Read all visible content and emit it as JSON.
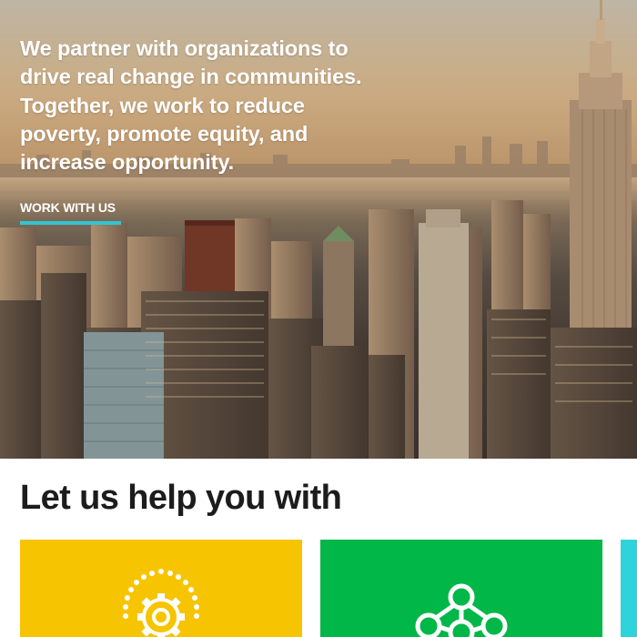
{
  "hero": {
    "text": "We partner with organizations to drive real change in communities. Together, we work to reduce poverty, promote equity, and increase opportunity.",
    "cta_label": "WORK WITH US",
    "accent_color": "#33c5d1"
  },
  "help_section": {
    "title": "Let us help you with",
    "cards": [
      {
        "color": "#f6c400",
        "icon": "gear-icon"
      },
      {
        "color": "#00b747",
        "icon": "network-icon"
      },
      {
        "color": "#2fd3dc",
        "icon": ""
      }
    ]
  }
}
